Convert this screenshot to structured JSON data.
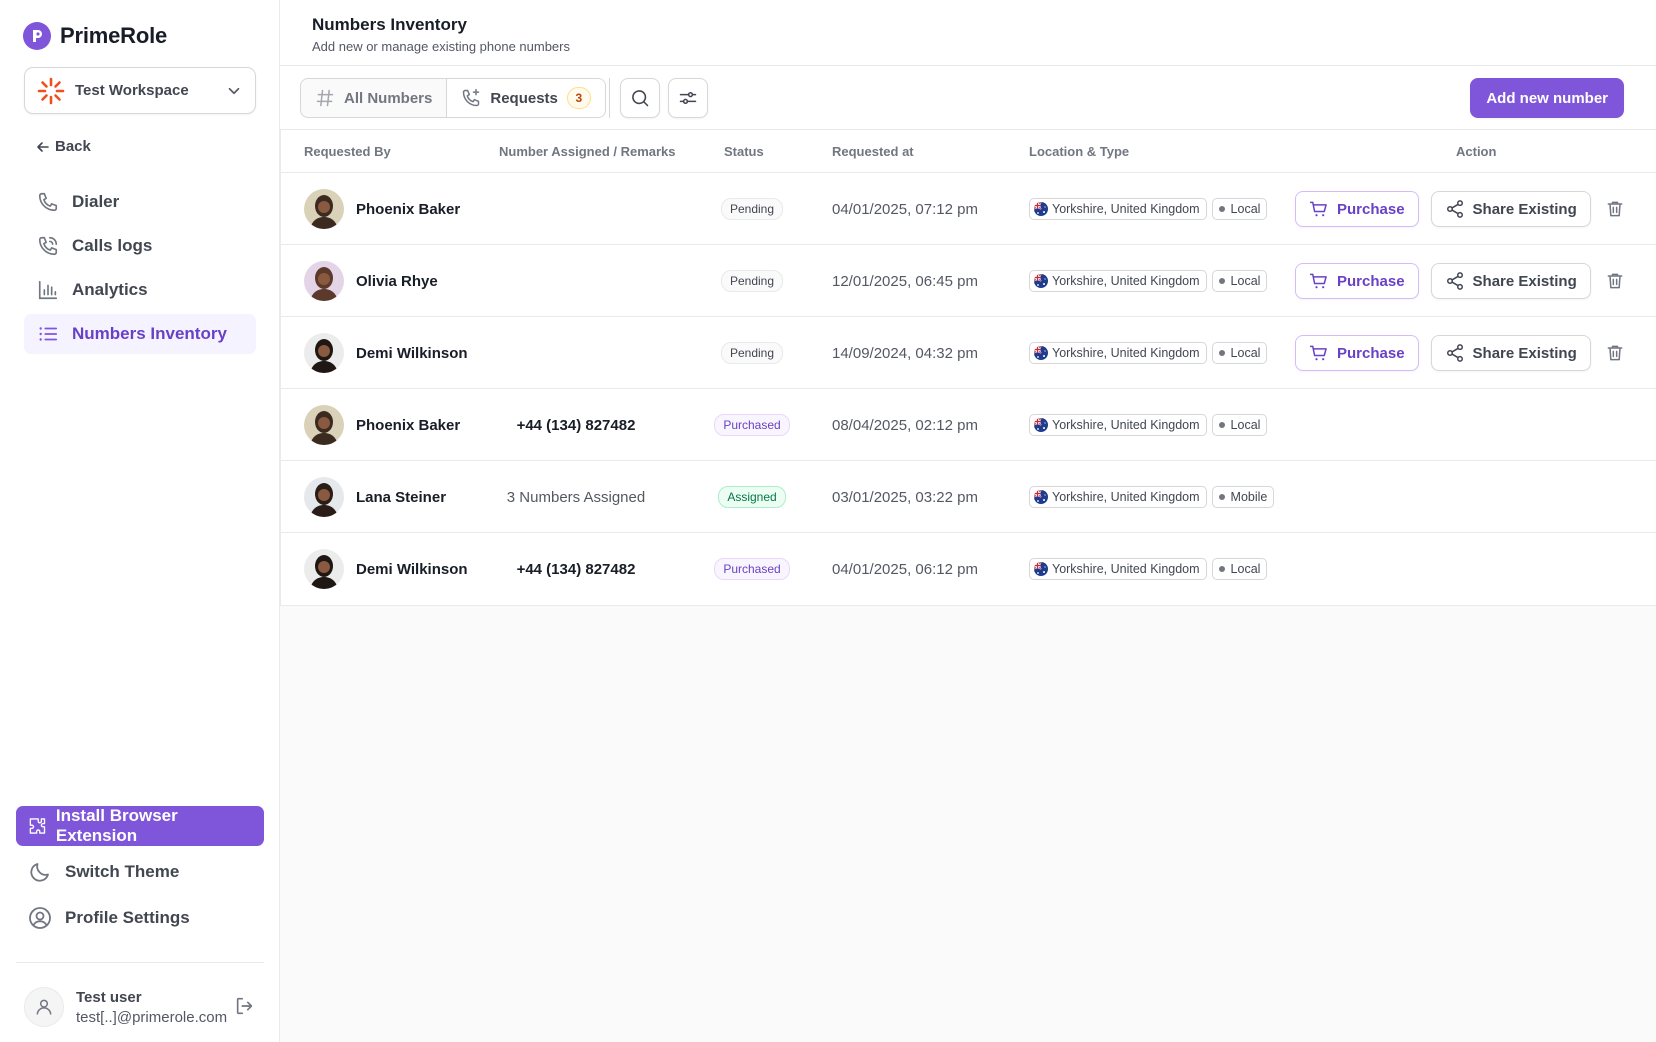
{
  "brand": {
    "name": "PrimeRole"
  },
  "workspace": {
    "name": "Test Workspace"
  },
  "sidebar": {
    "back_label": "Back",
    "nav": [
      {
        "label": "Dialer",
        "icon": "phone-icon"
      },
      {
        "label": "Calls logs",
        "icon": "phone-call-icon"
      },
      {
        "label": "Analytics",
        "icon": "bar-chart-icon"
      },
      {
        "label": "Numbers Inventory",
        "icon": "list-icon",
        "active": true
      }
    ],
    "extension_label": "Install Browser Extension",
    "theme_label": "Switch Theme",
    "profile_label": "Profile Settings"
  },
  "user": {
    "name": "Test user",
    "email": "test[..]@primerole.com"
  },
  "header": {
    "title": "Numbers Inventory",
    "subtitle": "Add new or manage existing phone numbers"
  },
  "toolbar": {
    "tab_all": "All Numbers",
    "tab_requests": "Requests",
    "requests_count": "3",
    "add_label": "Add new number"
  },
  "table": {
    "headers": {
      "requested_by": "Requested By",
      "assigned": "Number Assigned / Remarks",
      "status": "Status",
      "requested_at": "Requested at",
      "location": "Location & Type",
      "action": "Action"
    },
    "purchase_label": "Purchase",
    "share_label": "Share Existing",
    "rows": [
      {
        "name": "Phoenix Baker",
        "assigned": "",
        "status": "Pending",
        "date": "04/01/2025, 07:12 pm",
        "location": "Yorkshire, United Kingdom",
        "type": "Local"
      },
      {
        "name": "Olivia Rhye",
        "assigned": "",
        "status": "Pending",
        "date": "12/01/2025, 06:45 pm",
        "location": "Yorkshire, United Kingdom",
        "type": "Local"
      },
      {
        "name": "Demi Wilkinson",
        "assigned": "",
        "status": "Pending",
        "date": "14/09/2024, 04:32 pm",
        "location": "Yorkshire, United Kingdom",
        "type": "Local"
      },
      {
        "name": "Phoenix Baker",
        "assigned": "+44 (134) 827482",
        "status": "Purchased",
        "date": "08/04/2025, 02:12 pm",
        "location": "Yorkshire, United Kingdom",
        "type": "Local"
      },
      {
        "name": "Lana Steiner",
        "assigned": "3 Numbers Assigned",
        "status": "Assigned",
        "date": "03/01/2025, 03:22 pm",
        "location": "Yorkshire, United Kingdom",
        "type": "Mobile"
      },
      {
        "name": "Demi Wilkinson",
        "assigned": "+44 (134) 827482",
        "status": "Purchased",
        "date": "04/01/2025, 06:12 pm",
        "location": "Yorkshire, United Kingdom",
        "type": "Local"
      }
    ]
  },
  "colors": {
    "accent": "#7f56d9",
    "accent_text": "#6941c6",
    "pending_badge": "#fafafa",
    "purchased_badge": "#f9f5ff",
    "assigned_badge": "#ecfdf3"
  }
}
